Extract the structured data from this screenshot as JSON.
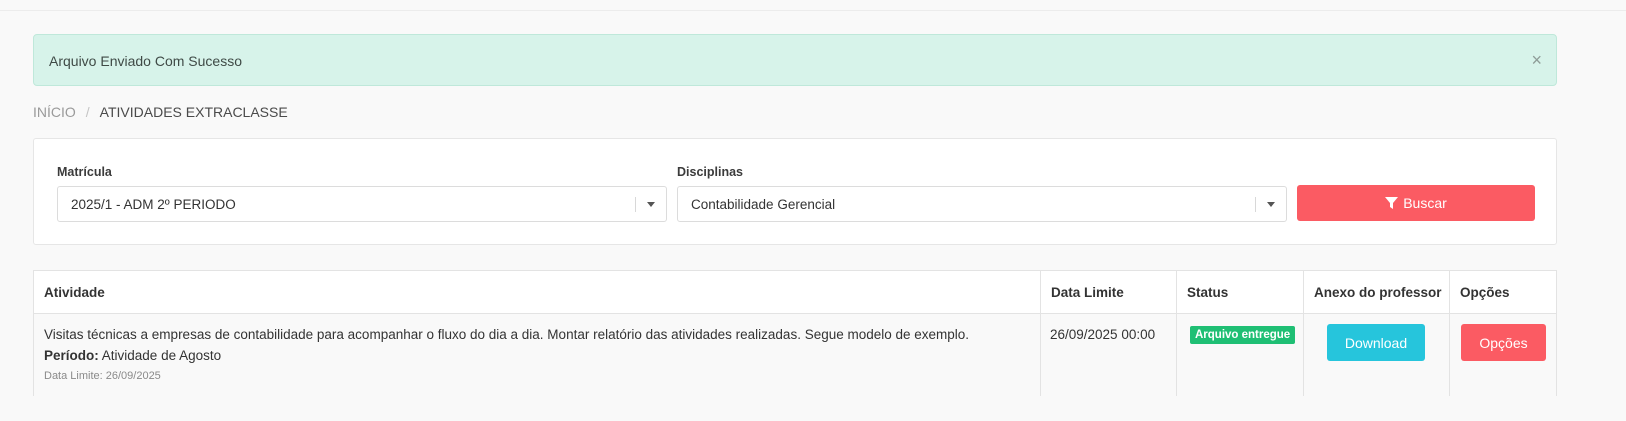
{
  "alert": {
    "message": "Arquivo Enviado Com Sucesso",
    "close_glyph": "×"
  },
  "breadcrumb": {
    "home": "INÍCIO",
    "separator": "/",
    "current": "ATIVIDADES EXTRACLASSE"
  },
  "filters": {
    "matricula_label": "Matrícula",
    "matricula_value": "2025/1 - ADM 2º PERIODO",
    "disciplinas_label": "Disciplinas",
    "disciplinas_value": "Contabilidade Gerencial",
    "search_button": "Buscar",
    "search_icon": "filter-icon"
  },
  "table": {
    "headers": {
      "atividade": "Atividade",
      "data_limite": "Data Limite",
      "status": "Status",
      "anexo": "Anexo do professor",
      "opcoes": "Opções"
    },
    "rows": [
      {
        "descricao": "Visitas técnicas a empresas de contabilidade para acompanhar o fluxo do dia a dia. Montar relatório das atividades realizadas. Segue modelo de exemplo.",
        "periodo_label": "Período:",
        "periodo_value": "Atividade de Agosto",
        "data_limite_small": "Data Limite: 26/09/2025",
        "data_limite": "26/09/2025 00:00",
        "status": "Arquivo entregue",
        "download_label": "Download",
        "opcoes_label": "Opções"
      }
    ]
  },
  "colors": {
    "primary_red": "#fb5b63",
    "info_cyan": "#26c5dc",
    "success_green": "#1fbf74",
    "alert_bg": "#d7f3ea"
  }
}
